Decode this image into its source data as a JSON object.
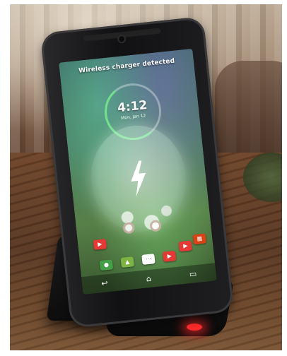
{
  "screen": {
    "notification": "Wireless charger detected",
    "time": "4:12",
    "date": "Mon, Jan 12"
  },
  "icons": {
    "charging": "lightning-bolt-icon",
    "back": "back-icon",
    "home": "home-icon",
    "recents": "recents-icon"
  },
  "colors": {
    "charging_led": "#ff2b2b",
    "clock_accent": "#6fe08b",
    "youtube_red": "#e53935"
  }
}
